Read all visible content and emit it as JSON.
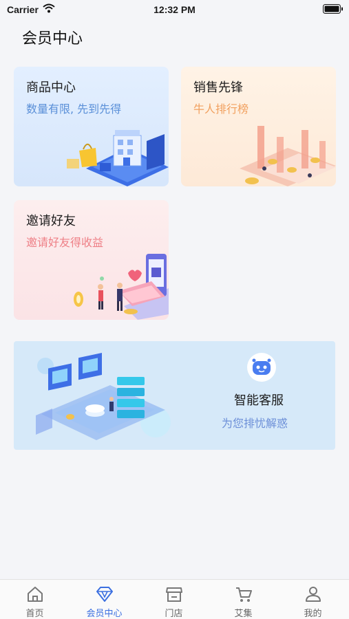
{
  "status_bar": {
    "carrier": "Carrier",
    "time": "12:32 PM"
  },
  "page": {
    "title": "会员中心"
  },
  "cards": {
    "products": {
      "title": "商品中心",
      "subtitle": "数量有限, 先到先得"
    },
    "sales": {
      "title": "销售先锋",
      "subtitle": "牛人排行榜"
    },
    "invite": {
      "title": "邀请好友",
      "subtitle": "邀请好友得收益"
    },
    "service": {
      "title": "智能客服",
      "subtitle": "为您排忧解惑"
    }
  },
  "tab_bar": {
    "active": "member",
    "items": [
      {
        "label": "首页",
        "icon": "home-icon"
      },
      {
        "label": "会员中心",
        "icon": "diamond-icon"
      },
      {
        "label": "门店",
        "icon": "store-icon"
      },
      {
        "label": "艾集",
        "icon": "cart-icon"
      },
      {
        "label": "我的",
        "icon": "user-icon"
      }
    ]
  },
  "colors": {
    "accent": "#3b6fe0",
    "products_sub": "#5a8fd8",
    "sales_sub": "#f1a05f",
    "invite_sub": "#ee7f86",
    "service_sub": "#6c8fd8"
  }
}
